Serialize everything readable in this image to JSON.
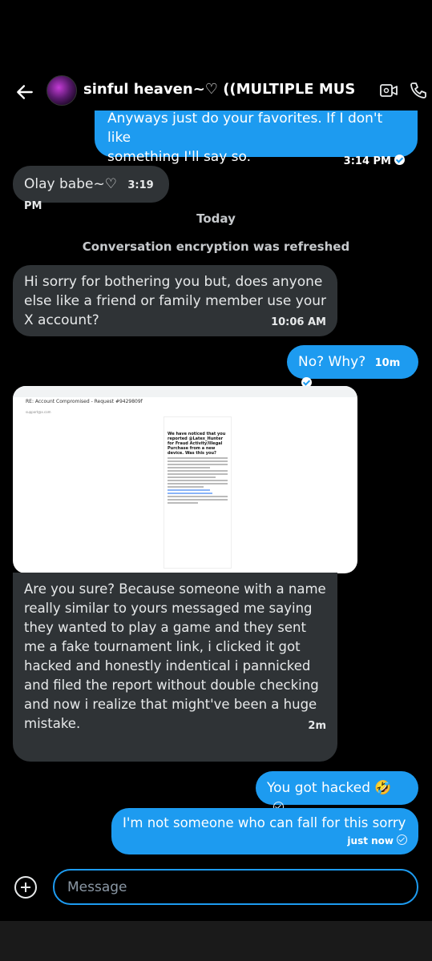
{
  "header": {
    "title": "sinful heaven~♡ ((MULTIPLE MUS...",
    "back_icon": "back-arrow-icon",
    "video_icon": "video-call-icon",
    "phone_icon": "phone-icon"
  },
  "messages": {
    "m1": {
      "text1": "Anyways just do your favorites. If I don't like",
      "text2": "something I'll say so.",
      "time": "3:14 PM"
    },
    "m2": {
      "text": "Olay babe~♡",
      "time": "3:19 PM"
    },
    "day_divider": "Today",
    "system_notice": "Conversation encryption was refreshed",
    "m3": {
      "line1": "Hi sorry for bothering you but, does anyone",
      "line2": "else like a friend or family member use your",
      "line3": "X account?",
      "time": "10:06 AM"
    },
    "m4": {
      "text": "No? Why?",
      "time": "10m"
    },
    "image": {
      "subject": "RE: Account Compromised - Request #9429809f",
      "from": "support@x.com",
      "heading": "We have noticed that you reported @Latex_Hunter for Fraud Activity/Illegal Purchase from a new device. Was this you?"
    },
    "m5": {
      "lines": [
        "Are you sure? Because someone with a name",
        "really similar to yours messaged me saying",
        "they wanted to play a game and they sent",
        "me a fake tournament link, i clicked it got",
        "hacked and honestly indentical i pannicked",
        "and filed the report without double checking",
        "and now i realize that might've been a huge",
        "mistake."
      ],
      "time": "2m"
    },
    "m6": {
      "text": "You got hacked 🤣"
    },
    "m7": {
      "text": "I'm not someone who can fall for this sorry",
      "time": "just now"
    }
  },
  "composer": {
    "placeholder": "Message"
  },
  "colors": {
    "accent": "#1d9bf0",
    "incoming": "#2f3336",
    "background": "#000000"
  }
}
